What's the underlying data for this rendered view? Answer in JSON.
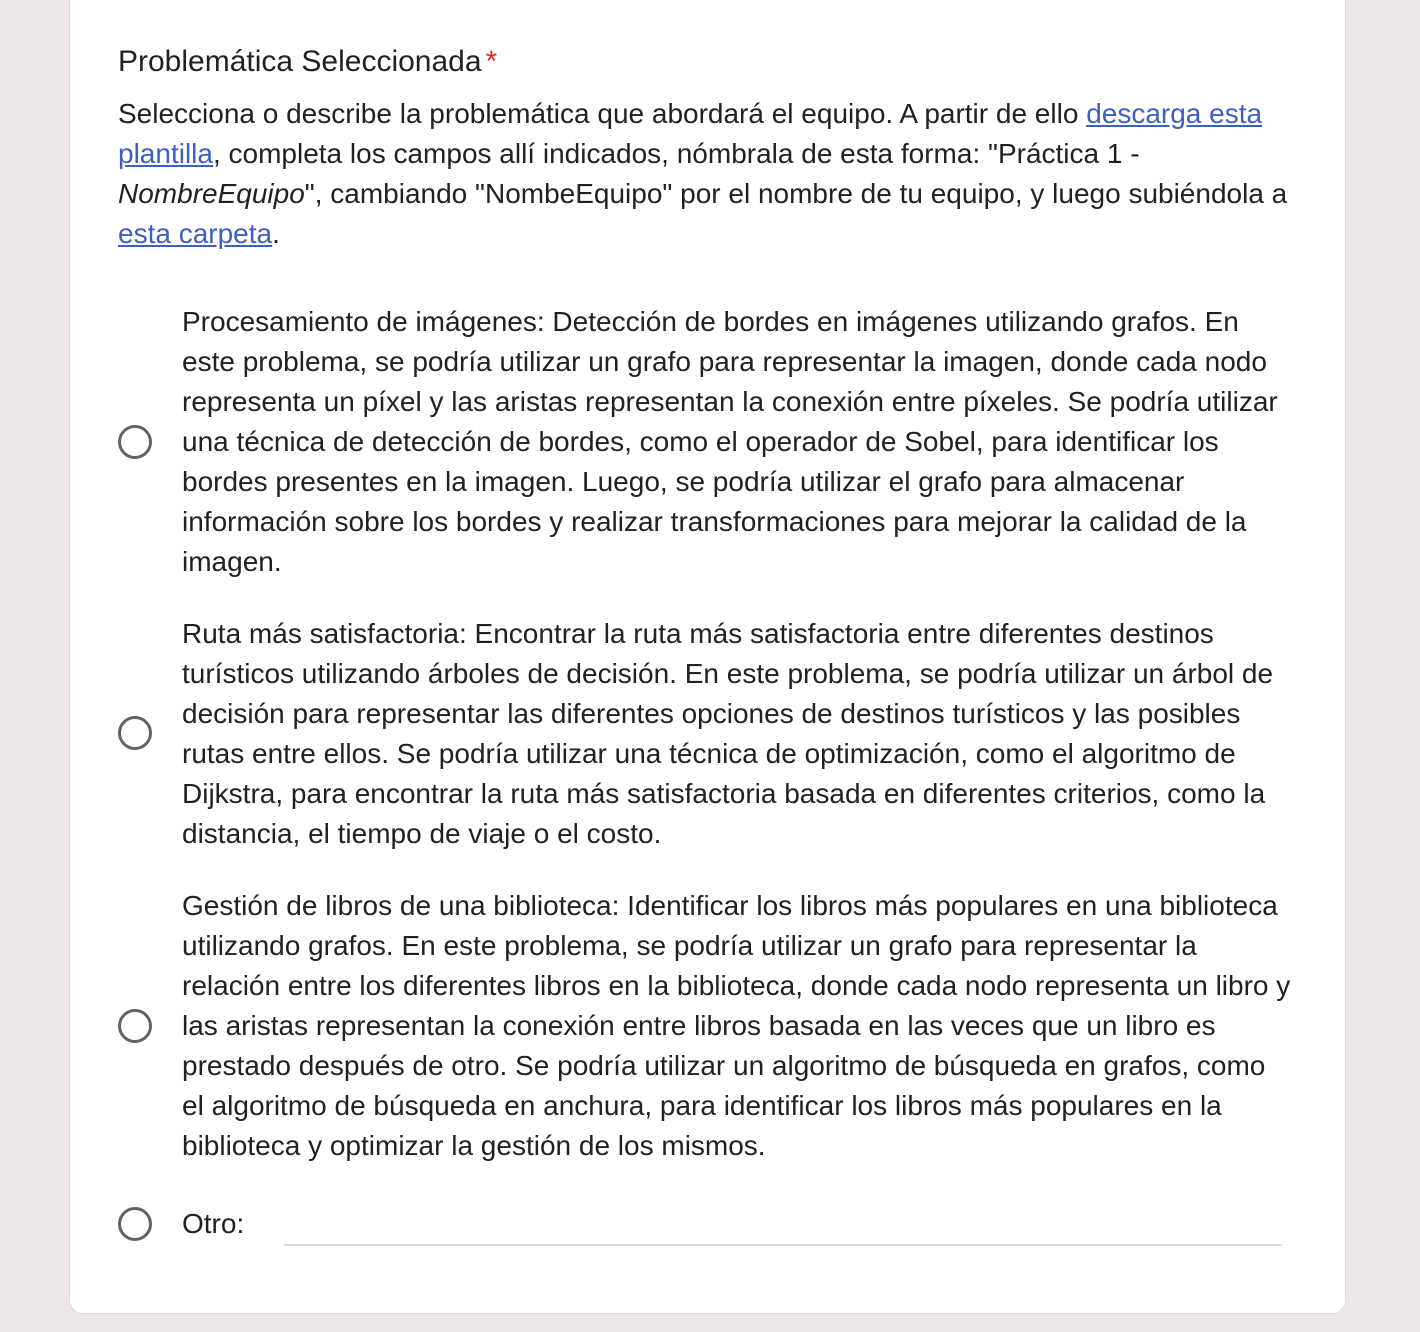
{
  "question": {
    "title": "Problemática Seleccionada",
    "required_marker": "*",
    "description": {
      "part1": "Selecciona o describe la problemática que abordará el equipo. A partir de ello ",
      "link1": "descarga esta plantilla",
      "part2": ", completa los campos allí indicados, nómbrala de esta forma: \"Práctica 1 - ",
      "italic": "NombreEquipo",
      "part3": "\", cambiando \"NombeEquipo\" por el nombre de tu equipo, y luego subiéndola a ",
      "link2": "esta carpeta",
      "part4": "."
    },
    "options": [
      {
        "label": "Procesamiento de imágenes: Detección de bordes en imágenes utilizando grafos. En este problema, se podría utilizar un grafo para representar la imagen, donde cada nodo representa un píxel y las aristas representan la conexión entre píxeles. Se podría utilizar una técnica de detección de bordes, como el operador de Sobel, para identificar los bordes presentes en la imagen. Luego, se podría utilizar el grafo para almacenar información sobre los bordes y realizar transformaciones para mejorar la calidad de la imagen."
      },
      {
        "label": "Ruta más satisfactoria: Encontrar la ruta más satisfactoria entre diferentes destinos turísticos utilizando árboles de decisión. En este problema, se podría utilizar un árbol de decisión para representar las diferentes opciones de destinos turísticos y las posibles rutas entre ellos. Se podría utilizar una técnica de optimización, como el algoritmo de Dijkstra, para encontrar la ruta más satisfactoria basada en diferentes criterios, como la distancia, el tiempo de viaje o el costo."
      },
      {
        "label": "Gestión de libros de una biblioteca: Identificar los libros más populares en una biblioteca utilizando grafos. En este problema, se podría utilizar un grafo para representar la relación entre los diferentes libros en la biblioteca, donde cada nodo representa un libro y las aristas representan la conexión entre libros basada en las veces que un libro es prestado después de otro. Se podría utilizar un algoritmo de búsqueda en grafos, como el algoritmo de búsqueda en anchura, para identificar los libros más populares en la biblioteca y optimizar la gestión de los mismos."
      }
    ],
    "other": {
      "label": "Otro:",
      "value": ""
    }
  },
  "colors": {
    "background": "#ede7e7",
    "card": "#ffffff",
    "link": "#3c5fc6",
    "required": "#d93025",
    "radio_border": "#5f6368"
  }
}
